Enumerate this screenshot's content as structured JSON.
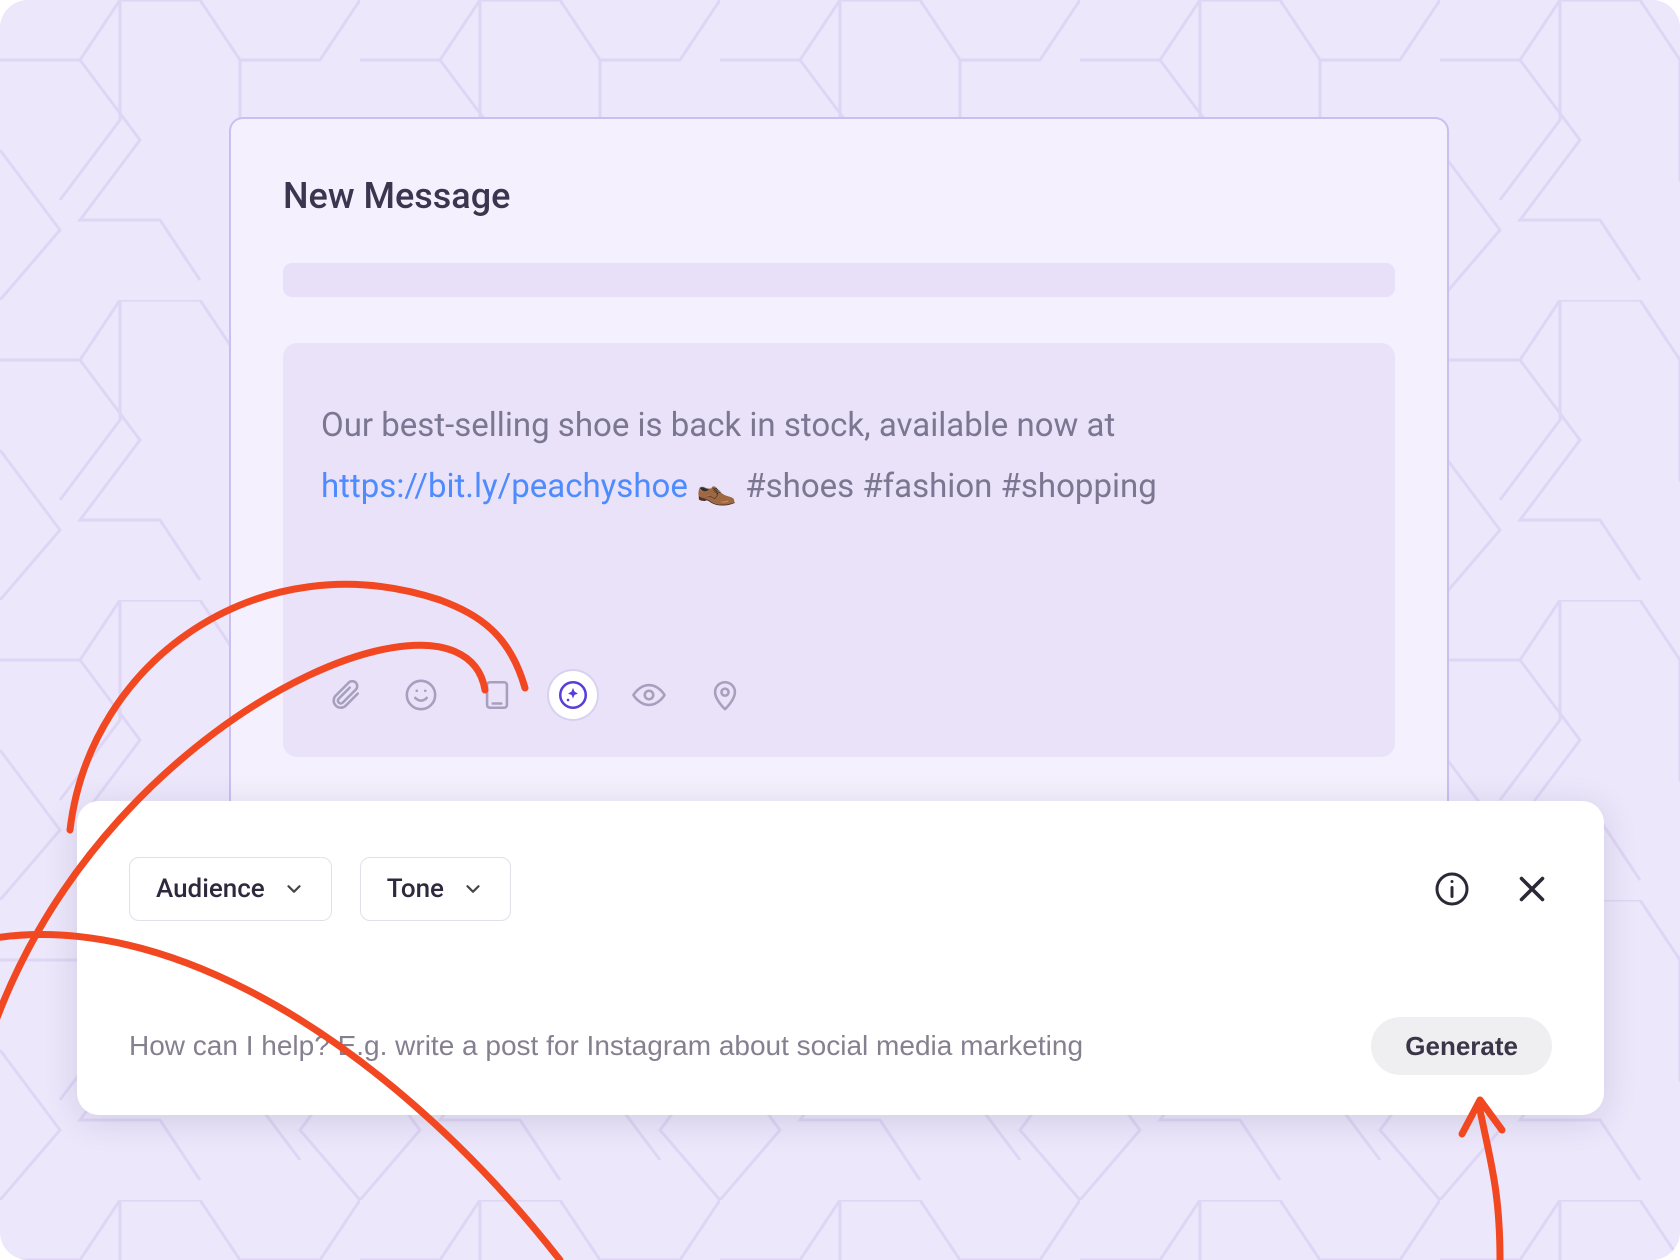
{
  "composer": {
    "title": "New Message",
    "message": {
      "text_before_link": "Our best-selling shoe is back in stock, available now at ",
      "link": "https://bit.ly/peachyshoe",
      "emoji": "👞",
      "hashtags": "#shoes #fashion #shopping"
    },
    "toolbar_icons": [
      "attachment",
      "emoji",
      "page",
      "ai-sparkle",
      "eye",
      "location"
    ],
    "toolbar_active_index": 3
  },
  "ai_panel": {
    "dropdowns": {
      "audience_label": "Audience",
      "tone_label": "Tone"
    },
    "input_placeholder": "How can I help? E.g. write a post for Instagram about social media marketing",
    "generate_label": "Generate"
  },
  "colors": {
    "bg": "#ece7fb",
    "card": "#f4f0fd",
    "card_border": "#cbbff0",
    "msg_body": "#e9e2f8",
    "link": "#4d8bff",
    "accent": "#5a3fd6",
    "annotation": "#f24822"
  }
}
